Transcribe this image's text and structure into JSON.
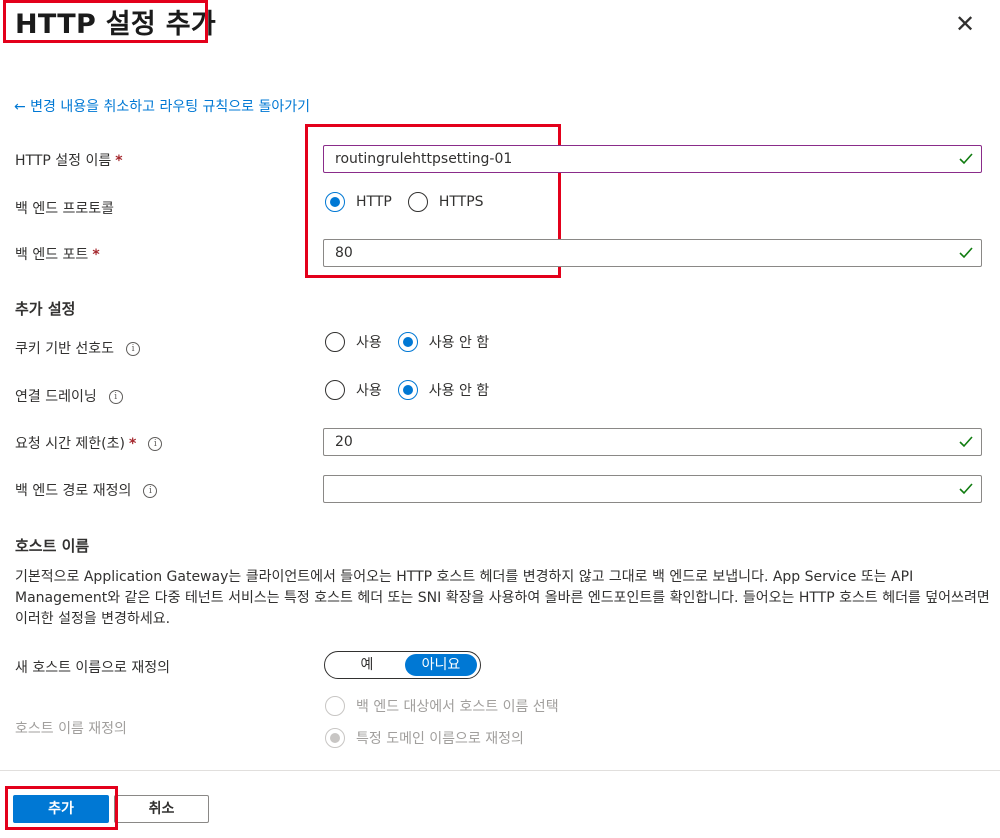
{
  "header": {
    "title": "HTTP 설정 추가",
    "close_label": "✕"
  },
  "back_link": "← 변경 내용을 취소하고 라우팅 규칙으로 돌아가기",
  "fields": {
    "setting_name": {
      "label": "HTTP 설정 이름",
      "required": "*",
      "value": "routingrulehttpsetting-01"
    },
    "protocol": {
      "label": "백 엔드 프로토콜",
      "options": [
        "HTTP",
        "HTTPS"
      ],
      "selected": "HTTP"
    },
    "port": {
      "label": "백 엔드 포트",
      "required": "*",
      "value": "80"
    }
  },
  "additional": {
    "heading": "추가 설정",
    "cookie_affinity": {
      "label": "쿠키 기반 선호도",
      "info": "i",
      "options": [
        "사용",
        "사용 안 함"
      ],
      "selected": "사용 안 함"
    },
    "connection_draining": {
      "label": "연결 드레이닝",
      "info": "i",
      "options": [
        "사용",
        "사용 안 함"
      ],
      "selected": "사용 안 함"
    },
    "request_timeout": {
      "label": "요청 시간 제한(초)",
      "required": "*",
      "info": "i",
      "value": "20"
    },
    "path_override": {
      "label": "백 엔드 경로 재정의",
      "info": "i",
      "value": ""
    }
  },
  "host": {
    "heading": "호스트 이름",
    "description": "기본적으로 Application Gateway는 클라이언트에서 들어오는 HTTP 호스트 헤더를 변경하지 않고 그대로 백 엔드로 보냅니다. App Service 또는 API Management와 같은 다중 테넌트 서비스는 특정 호스트 헤더 또는 SNI 확장을 사용하여 올바른 엔드포인트를 확인합니다. 들어오는 HTTP 호스트 헤더를 덮어쓰려면 이러한 설정을 변경하세요.",
    "override_label": "새 호스트 이름으로 재정의",
    "toggle": {
      "yes": "예",
      "no": "아니요",
      "selected": "아니요"
    },
    "hostname_override_label": "호스트 이름 재정의",
    "hostname_options": [
      "백 엔드 대상에서 호스트 이름 선택",
      "특정 도메인 이름으로 재정의"
    ],
    "hostname_selected": "특정 도메인 이름으로 재정의"
  },
  "footer": {
    "add_button": "추가",
    "cancel_button": "취소"
  },
  "colors": {
    "accent": "#0078d4",
    "highlight_box": "#e3001b",
    "valid_check": "#107c10",
    "required": "#a4262c"
  }
}
